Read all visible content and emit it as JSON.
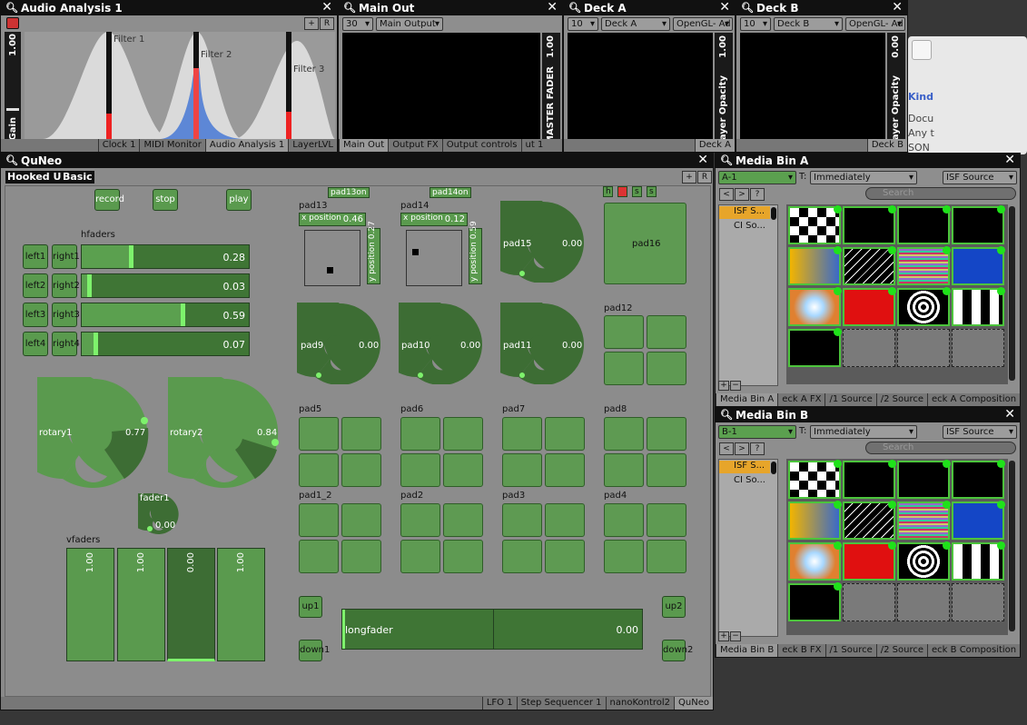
{
  "audio": {
    "title": "Audio Analysis 1",
    "gain_label": "Gain",
    "gain_value": "1.00",
    "filters": [
      "Filter 1",
      "Filter 2",
      "Filter 3"
    ],
    "tabs": [
      "Clock 1",
      "MIDI Monitor",
      "Audio Analysis 1",
      "LayerLVL"
    ]
  },
  "mainout": {
    "title": "Main Out",
    "fps": "30",
    "output": "Main Output",
    "master_label": "MASTER FADER",
    "master_value": "1.00",
    "tabs": [
      "Main Out",
      "Output FX",
      "Output controls",
      "ut 1"
    ]
  },
  "deckA": {
    "title": "Deck A",
    "fps": "10",
    "deck": "Deck A",
    "renderer": "OpenGL- Ad",
    "opacity_label": "Layer Opacity",
    "opacity_value": "1.00",
    "tab": "Deck A"
  },
  "deckB": {
    "title": "Deck B",
    "fps": "10",
    "deck": "Deck B",
    "renderer": "OpenGL- Ad",
    "opacity_label": "Layer Opacity",
    "opacity_value": "0.00",
    "tab": "Deck B"
  },
  "bgwin": {
    "kind": "Kind",
    "docu": "Docu",
    "any": "Any t",
    "son": "SON"
  },
  "quneo": {
    "title": "QuNeo",
    "hooked": "Hooked Up",
    "basic": "Basic",
    "record": "record",
    "stop": "stop",
    "play": "play",
    "hfaders_label": "hfaders",
    "lefts": [
      "left1",
      "left2",
      "left3",
      "left4"
    ],
    "rights": [
      "right1",
      "right2",
      "right3",
      "right4"
    ],
    "hfaders": [
      {
        "value": "0.28",
        "level": 0.28
      },
      {
        "value": "0.03",
        "level": 0.03
      },
      {
        "value": "0.59",
        "level": 0.59
      },
      {
        "value": "0.07",
        "level": 0.07
      }
    ],
    "rotary1": {
      "label": "rotary1",
      "value": "0.77"
    },
    "rotary2": {
      "label": "rotary2",
      "value": "0.84"
    },
    "fader1": {
      "label": "fader1",
      "value": "0.00"
    },
    "vfaders_label": "vfaders",
    "vfaders": [
      "1.00",
      "1.00",
      "0.00",
      "1.00"
    ],
    "pad13on": "pad13on",
    "pad14on": "pad14on",
    "pad13": {
      "label": "pad13",
      "xpos": "x position",
      "xval": "0.46",
      "ypos": "y position",
      "yval": "0.27"
    },
    "pad14": {
      "label": "pad14",
      "xpos": "x position",
      "xval": "0.12",
      "ypos": "y position",
      "yval": "0.59"
    },
    "pad15": {
      "label": "pad15",
      "value": "0.00"
    },
    "pad16": "pad16",
    "pad12": "pad12",
    "pad9": {
      "label": "pad9",
      "value": "0.00"
    },
    "pad10": {
      "label": "pad10",
      "value": "0.00"
    },
    "pad11": {
      "label": "pad11",
      "value": "0.00"
    },
    "pad_groups": [
      "pad5",
      "pad6",
      "pad7",
      "pad8",
      "pad1_2",
      "pad2",
      "pad3",
      "pad4"
    ],
    "up1": "up1",
    "down1": "down1",
    "up2": "up2",
    "down2": "down2",
    "longfader": {
      "label": "longfader",
      "value": "0.00"
    },
    "small_buttons": [
      "h",
      "",
      "s",
      "s"
    ],
    "tabs": [
      "LFO 1",
      "Step Sequencer 1",
      "nanoKontrol2",
      "QuNeo"
    ]
  },
  "binA": {
    "title": "Media Bin A",
    "page": "A-1",
    "trigger_label": "T:",
    "trigger": "Immediately",
    "source": "ISF Source",
    "search": "Search",
    "items": [
      "ISF S...",
      "CI So..."
    ],
    "tabs": [
      "Media Bin A",
      "eck A FX",
      "/1 Source",
      "/2 Source",
      "eck A Composition"
    ]
  },
  "binB": {
    "title": "Media Bin B",
    "page": "B-1",
    "trigger_label": "T:",
    "trigger": "Immediately",
    "source": "ISF Source",
    "search": "Search",
    "items": [
      "ISF S...",
      "CI So..."
    ],
    "tabs": [
      "Media Bin B",
      "eck B FX",
      "/1 Source",
      "/2 Source",
      "eck B Composition"
    ]
  }
}
